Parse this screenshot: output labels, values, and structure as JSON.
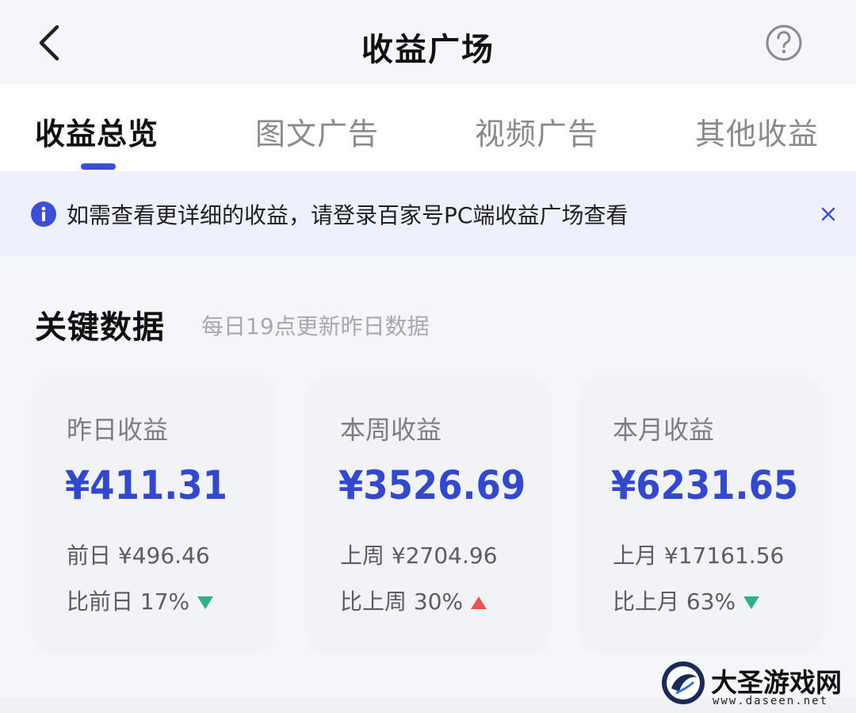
{
  "header": {
    "title": "收益广场",
    "back_icon": "chevron-left-icon",
    "help_icon": "question-circle-icon"
  },
  "tabs": [
    {
      "label": "收益总览",
      "active": true
    },
    {
      "label": "图文广告",
      "active": false
    },
    {
      "label": "视频广告",
      "active": false
    },
    {
      "label": "其他收益",
      "active": false
    }
  ],
  "notice": {
    "icon": "info-icon",
    "text": "如需查看更详细的收益，请登录百家号PC端收益广场查看",
    "close_icon": "close-icon"
  },
  "section": {
    "title": "关键数据",
    "subtitle": "每日19点更新昨日数据"
  },
  "cards": [
    {
      "label": "昨日收益",
      "amount": "¥411.31",
      "prev": "前日 ¥496.46",
      "cmp": "比前日 17%",
      "trend": "down"
    },
    {
      "label": "本周收益",
      "amount": "¥3526.69",
      "prev": "上周 ¥2704.96",
      "cmp": "比上周 30%",
      "trend": "up"
    },
    {
      "label": "本月收益",
      "amount": "¥6231.65",
      "prev": "上月 ¥17161.56",
      "cmp": "比上月 63%",
      "trend": "down"
    }
  ],
  "watermark": {
    "text": "大圣游戏网",
    "url": "www.daseen.net"
  },
  "colors": {
    "accent": "#3348cc",
    "down": "#2fb086",
    "up": "#e85454",
    "notice_bg": "#eef1fb"
  }
}
